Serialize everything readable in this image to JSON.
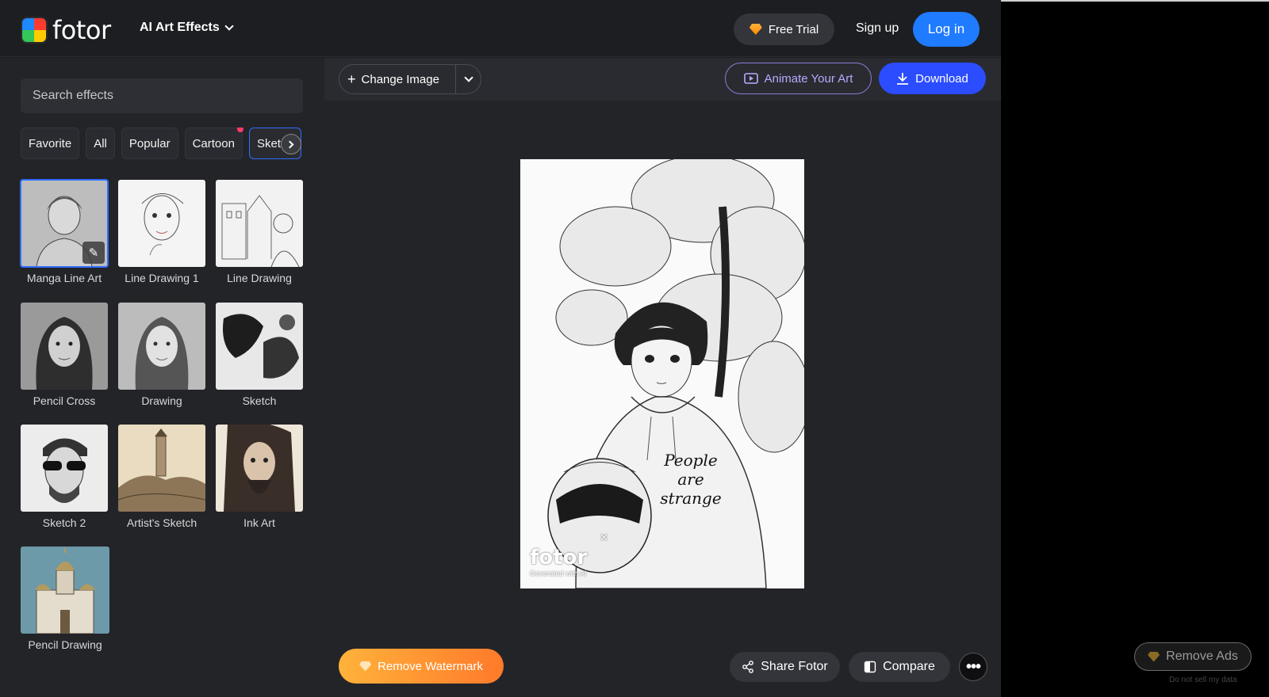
{
  "header": {
    "logo_text": "fotor",
    "nav_effects": "AI Art Effects",
    "free_trial": "Free Trial",
    "sign_up": "Sign up",
    "log_in": "Log in"
  },
  "sidebar": {
    "search_placeholder": "Search effects",
    "categories": [
      "Favorite",
      "All",
      "Popular",
      "Cartoon",
      "Sketch"
    ],
    "effects": [
      {
        "label": "Manga Line Art"
      },
      {
        "label": "Line Drawing 1"
      },
      {
        "label": "Line Drawing"
      },
      {
        "label": "Pencil Cross"
      },
      {
        "label": "Drawing"
      },
      {
        "label": "Sketch"
      },
      {
        "label": "Sketch 2"
      },
      {
        "label": "Artist's Sketch"
      },
      {
        "label": "Ink Art"
      },
      {
        "label": "Pencil Drawing"
      }
    ]
  },
  "toolbar": {
    "change_image": "Change Image",
    "animate": "Animate Your Art",
    "download": "Download"
  },
  "canvas": {
    "watermark_logo": "fotor",
    "watermark_sub": "Generated with AI",
    "shirt_text_line1": "People",
    "shirt_text_line2": "are strange"
  },
  "footer": {
    "remove_watermark": "Remove Watermark",
    "share": "Share Fotor",
    "compare": "Compare"
  },
  "ads": {
    "remove_ads": "Remove Ads",
    "do_not_sell": "Do not sell my data"
  },
  "colors": {
    "primary_blue": "#1f7bff",
    "download_blue": "#2b4cff",
    "accent_orange": "#ff8a00",
    "animate_purple": "#b7a9ff"
  }
}
